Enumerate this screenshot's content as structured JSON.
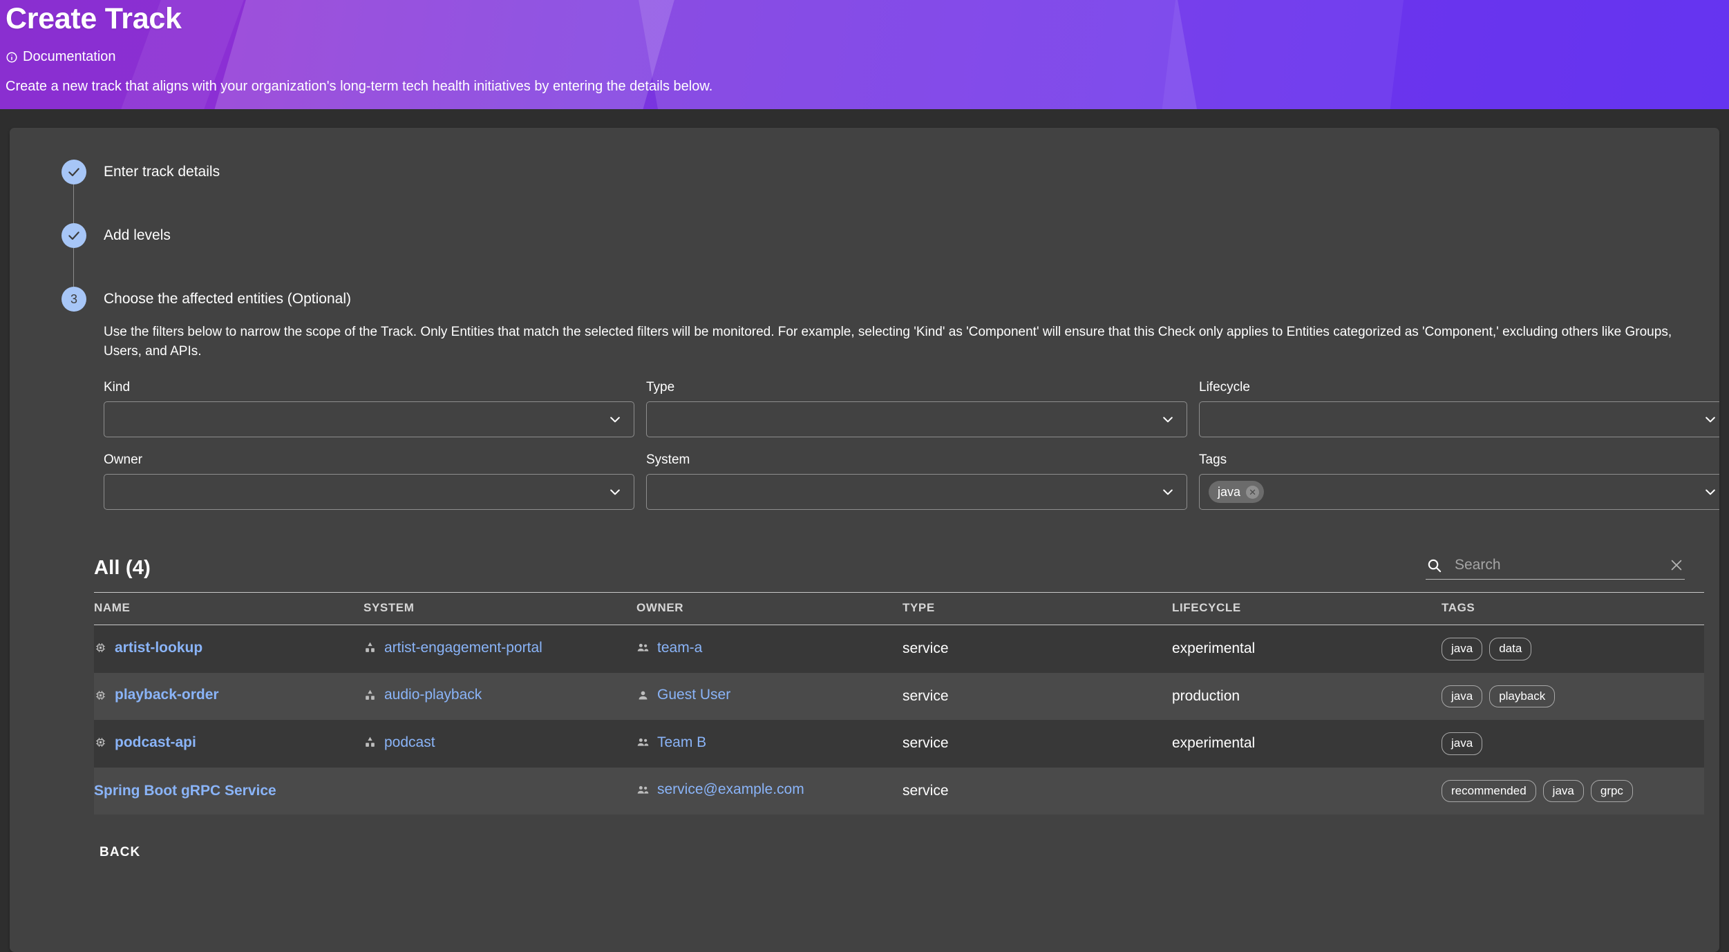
{
  "banner": {
    "title": "Create Track",
    "doc_link": "Documentation",
    "doc_icon": "info-icon",
    "description": "Create a new track that aligns with your organization's long-term tech health initiatives by entering the details below.",
    "accent_start": "#8a2fd0",
    "accent_end": "#6534f0"
  },
  "stepper": {
    "steps": [
      {
        "marker": "✓",
        "label": "Enter track details",
        "state": "complete"
      },
      {
        "marker": "✓",
        "label": "Add levels",
        "state": "complete"
      },
      {
        "marker": "3",
        "label": "Choose the affected entities (Optional)",
        "state": "active"
      }
    ],
    "active_description": "Use the filters below to narrow the scope of the Track. Only Entities that match the selected filters will be monitored. For example, selecting 'Kind' as 'Component' will ensure that this Check only applies to Entities categorized as 'Component,' excluding others like Groups, Users, and APIs.",
    "marker_color": "#a7c6f7"
  },
  "filters": [
    {
      "label": "Kind",
      "value": "",
      "chips": []
    },
    {
      "label": "Type",
      "value": "",
      "chips": []
    },
    {
      "label": "Lifecycle",
      "value": "",
      "chips": []
    },
    {
      "label": "Owner",
      "value": "",
      "chips": []
    },
    {
      "label": "System",
      "value": "",
      "chips": []
    },
    {
      "label": "Tags",
      "value": "",
      "chips": [
        "java"
      ]
    }
  ],
  "table": {
    "title": "All (4)",
    "search": {
      "placeholder": "Search",
      "value": "",
      "search_icon": "search-icon",
      "clear_icon": "close-icon"
    },
    "columns": [
      "NAME",
      "SYSTEM",
      "OWNER",
      "TYPE",
      "LIFECYCLE",
      "TAGS"
    ],
    "rows": [
      {
        "name": "artist-lookup",
        "name_icon": "component-icon",
        "name_link": true,
        "system": "artist-engagement-portal",
        "system_icon": "system-icon",
        "owner": "team-a",
        "owner_icon": "group-icon",
        "type": "service",
        "lifecycle": "experimental",
        "tags": [
          "java",
          "data"
        ]
      },
      {
        "name": "playback-order",
        "name_icon": "component-icon",
        "name_link": true,
        "system": "audio-playback",
        "system_icon": "system-icon",
        "owner": "Guest User",
        "owner_icon": "user-icon",
        "type": "service",
        "lifecycle": "production",
        "tags": [
          "java",
          "playback"
        ]
      },
      {
        "name": "podcast-api",
        "name_icon": "component-icon",
        "name_link": true,
        "system": "podcast",
        "system_icon": "system-icon",
        "owner": "Team B",
        "owner_icon": "group-icon",
        "type": "service",
        "lifecycle": "experimental",
        "tags": [
          "java"
        ]
      },
      {
        "name": "Spring Boot gRPC Service",
        "name_icon": "",
        "name_link": true,
        "system": "",
        "system_icon": "",
        "owner": "service@example.com",
        "owner_icon": "group-icon",
        "type": "service",
        "lifecycle": "",
        "tags": [
          "recommended",
          "java",
          "grpc"
        ]
      }
    ]
  },
  "footer": {
    "back_label": "BACK"
  },
  "colors": {
    "page_bg": "#2e2e2e",
    "card_bg": "#424242",
    "row_odd": "#383838",
    "row_even": "#4a4a4a",
    "link": "#8ab4f8"
  }
}
